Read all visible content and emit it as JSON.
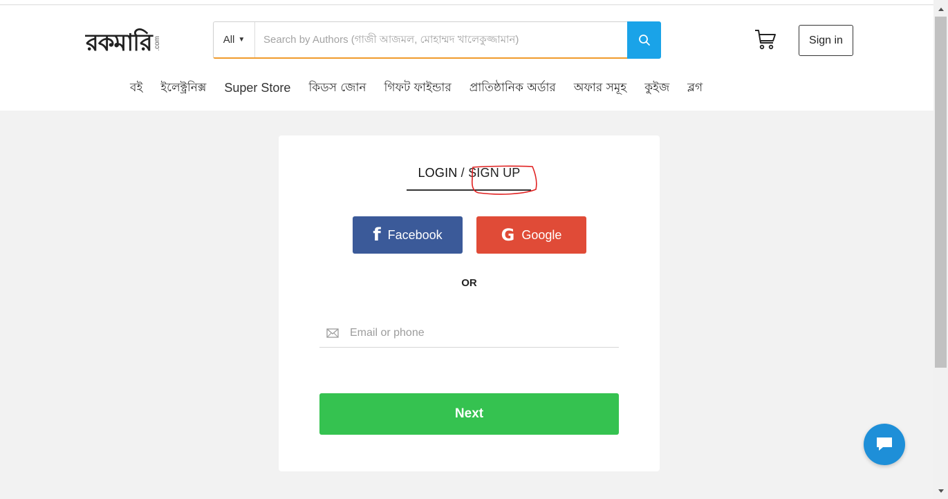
{
  "header": {
    "logo_text": "রকমারি",
    "logo_suffix": ".com",
    "search": {
      "category": "All",
      "placeholder": "Search by Authors (গাজী আজমল, মোহাম্মদ খালেকুজ্জামান)"
    },
    "signin_label": "Sign in"
  },
  "nav": {
    "items": [
      "বই",
      "ইলেক্ট্রনিক্স",
      "Super Store",
      "কিডস জোন",
      "গিফট ফাইন্ডার",
      "প্রাতিষ্ঠানিক অর্ডার",
      "অফার সমূহ",
      "কুইজ",
      "ব্লগ"
    ]
  },
  "card": {
    "tab_login": "LOGIN",
    "tab_separator": " / ",
    "tab_signup": "SIGN UP",
    "facebook_label": "Facebook",
    "google_label": "Google",
    "or_label": "OR",
    "email_placeholder": "Email or phone",
    "next_label": "Next"
  },
  "colors": {
    "search_button": "#1aa3e8",
    "search_underline": "#f09a2a",
    "facebook": "#3b5a99",
    "google": "#e04b37",
    "next": "#35c250",
    "chat": "#1e8fd8",
    "annotation": "#e02020"
  },
  "icons": {
    "search_button": "search-icon",
    "cart": "cart-icon",
    "facebook": "facebook-icon",
    "google": "google-icon",
    "email": "mail-icon",
    "chat": "chat-icon"
  }
}
